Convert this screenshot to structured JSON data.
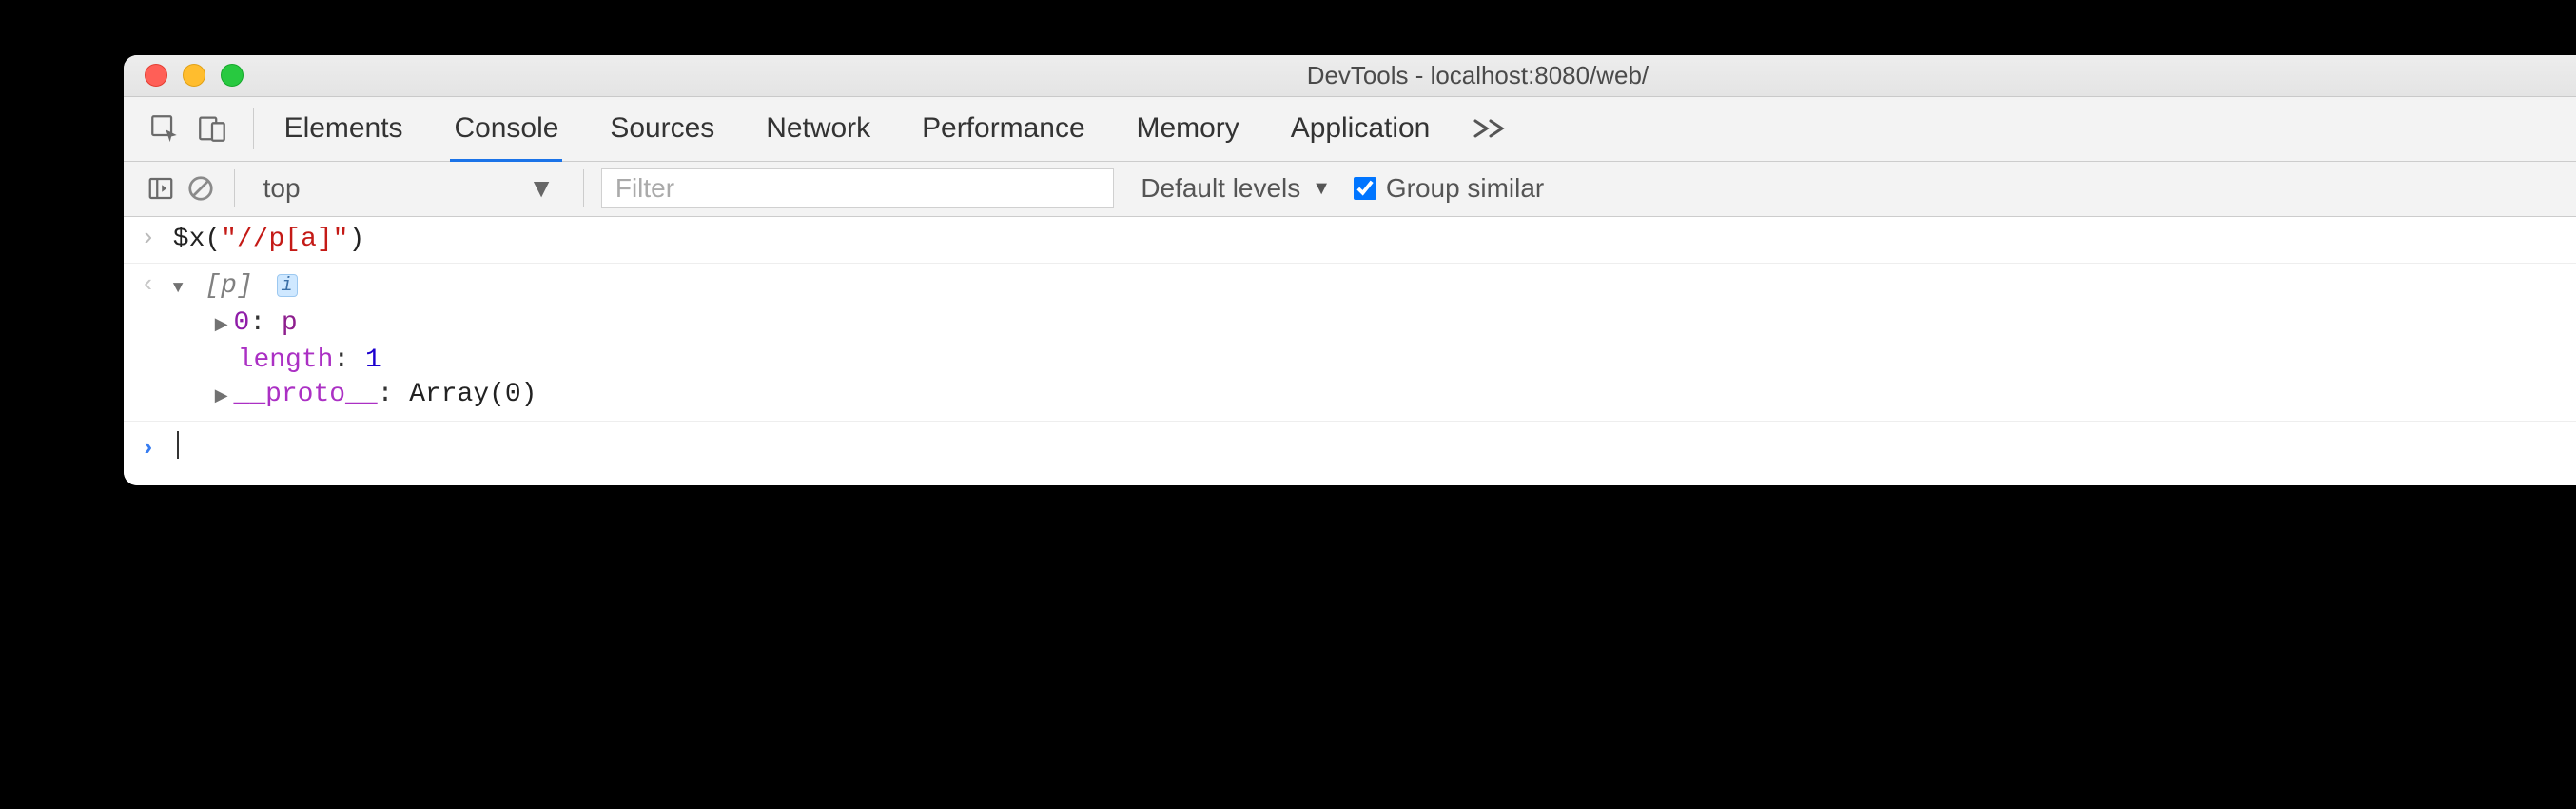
{
  "window": {
    "title": "DevTools - localhost:8080/web/"
  },
  "tabs": {
    "items": [
      "Elements",
      "Console",
      "Sources",
      "Network",
      "Performance",
      "Memory",
      "Application"
    ],
    "active_index": 1
  },
  "toolbar": {
    "context": "top",
    "filter_placeholder": "Filter",
    "levels_label": "Default levels",
    "group_similar_label": "Group similar",
    "group_similar_checked": true
  },
  "console": {
    "input": {
      "fn": "$x",
      "open": "(",
      "arg": "\"//p[a]\"",
      "close": ")"
    },
    "result": {
      "preview_open": "[",
      "preview_item": "p",
      "preview_close": "]",
      "entries": [
        {
          "kind": "index",
          "key": "0",
          "sep": ": ",
          "value": "p"
        },
        {
          "kind": "prop",
          "key": "length",
          "sep": ": ",
          "value": "1"
        },
        {
          "kind": "proto",
          "key": "__proto__",
          "sep": ": ",
          "value": "Array(0)"
        }
      ]
    }
  }
}
